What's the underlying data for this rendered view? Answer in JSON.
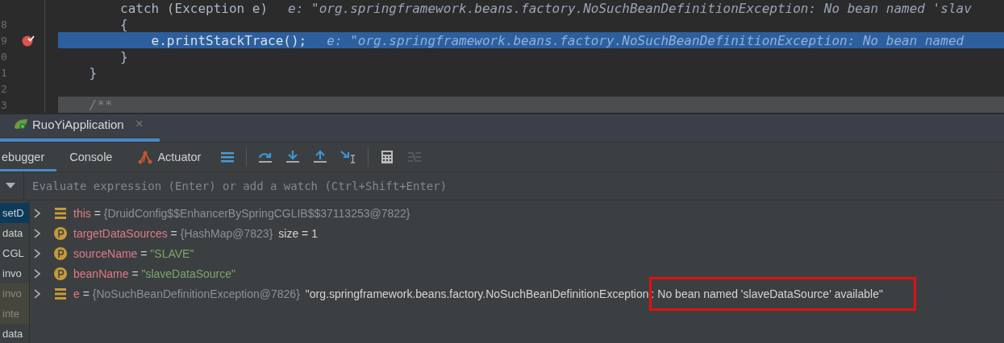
{
  "editor": {
    "lines": [
      {
        "kind": "code",
        "code": "        catch (Exception e)",
        "hint": "e: \"org.springframework.beans.factory.NoSuchBeanDefinitionException: No bean named 'slav",
        "current": false,
        "breakpoint": false
      },
      {
        "number": "8",
        "kind": "code",
        "code": "        {",
        "current": false,
        "breakpoint": false
      },
      {
        "number": "9",
        "kind": "code",
        "code": "            e.printStackTrace();",
        "hint": "e: \"org.springframework.beans.factory.NoSuchBeanDefinitionException: No bean named",
        "current": true,
        "breakpoint": true
      },
      {
        "number": "0",
        "kind": "code",
        "code": "        }",
        "current": false,
        "breakpoint": false
      },
      {
        "number": "1",
        "kind": "code",
        "code": "    }",
        "current": false,
        "breakpoint": false
      },
      {
        "number": "2",
        "kind": "code",
        "current": false,
        "breakpoint": false
      },
      {
        "number": "3",
        "kind": "comment",
        "code": "    /**",
        "current": false,
        "breakpoint": false
      }
    ]
  },
  "run_tab": {
    "title": "RuoYiApplication",
    "close": "×"
  },
  "tabs": [
    {
      "label": "ebugger",
      "selected": true,
      "icon": false
    },
    {
      "label": "Console",
      "selected": false,
      "icon": false
    },
    {
      "label": "Actuator",
      "selected": false,
      "icon": true
    }
  ],
  "evaluate": {
    "placeholder": "Evaluate expression (Enter) or add a watch (Ctrl+Shift+Enter)"
  },
  "frames": [
    {
      "label": "setD",
      "selected": true,
      "dimmed": false
    },
    {
      "label": "data",
      "selected": false,
      "dimmed": false
    },
    {
      "label": "CGL",
      "selected": false,
      "dimmed": false
    },
    {
      "label": "invo",
      "selected": false,
      "dimmed": false
    },
    {
      "label": "invo",
      "selected": false,
      "dimmed": true
    },
    {
      "label": "inte",
      "selected": false,
      "dimmed": true
    },
    {
      "label": "data",
      "selected": false,
      "dimmed": false
    }
  ],
  "variables": [
    {
      "kind": "local",
      "name": "this",
      "separator": "=",
      "object": "{DruidConfig$$EnhancerBySpringCGLIB$$37113253@7822}"
    },
    {
      "kind": "field",
      "name": "targetDataSources",
      "separator": "=",
      "object": "{HashMap@7823}",
      "detail": "size = 1"
    },
    {
      "kind": "field",
      "name": "sourceName",
      "separator": "=",
      "string": "\"SLAVE\""
    },
    {
      "kind": "field",
      "name": "beanName",
      "separator": "=",
      "string": "\"slaveDataSource\""
    },
    {
      "kind": "local",
      "name": "e",
      "separator": "=",
      "object": "{NoSuchBeanDefinitionException@7826}",
      "detail": "\"org.springframework.beans.factory.NoSuchBeanDefinitionException",
      "highlighted": ": No bean named 'slaveDataSource' available\""
    }
  ]
}
